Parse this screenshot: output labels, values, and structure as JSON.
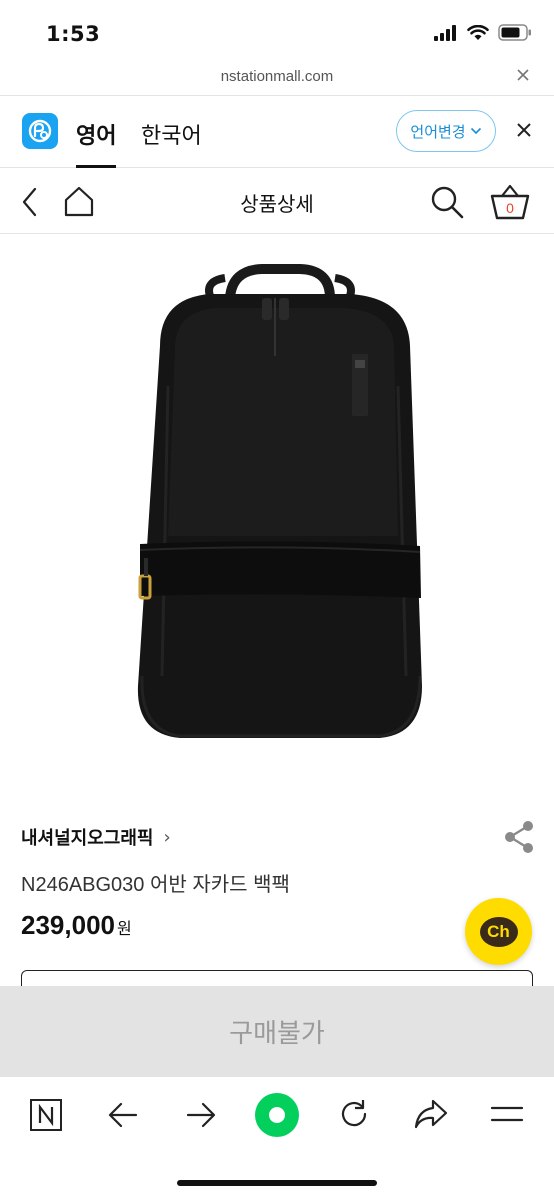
{
  "status_bar": {
    "time": "1:53",
    "icons": [
      "signal-icon",
      "wifi-icon",
      "battery-icon"
    ]
  },
  "url_bar": {
    "domain": "nstationmall.com",
    "close_icon": "close-icon"
  },
  "translate_bar": {
    "logo_icon": "papago-logo-icon",
    "active_language": "영어",
    "target_language": "한국어",
    "change_language_label": "언어변경",
    "close_icon": "close-icon",
    "accent_color": "#1a8fd8"
  },
  "page_header": {
    "title": "상품상세",
    "back_icon": "chevron-left-icon",
    "home_icon": "home-icon",
    "search_icon": "search-icon",
    "cart_icon": "basket-icon",
    "cart_count": "0",
    "cart_badge_color": "#e8442a"
  },
  "product": {
    "image": "black-backpack-product-photo",
    "brand": "내셔널지오그래픽",
    "brand_chevron": "›",
    "name": "N246ABG030 어반 자카드 백팩",
    "price": "239,000",
    "price_unit": "원",
    "share_icon": "share-icon"
  },
  "kakao_chat": {
    "label": "Ch",
    "color": "#fedc00"
  },
  "purchase": {
    "label": "구매불가"
  },
  "browser_toolbar": {
    "items": [
      "naver-icon",
      "back-arrow-icon",
      "forward-arrow-icon",
      "green-dot-icon",
      "refresh-icon",
      "share-arrow-icon",
      "menu-icon"
    ],
    "accent_color": "#03cf5d"
  }
}
